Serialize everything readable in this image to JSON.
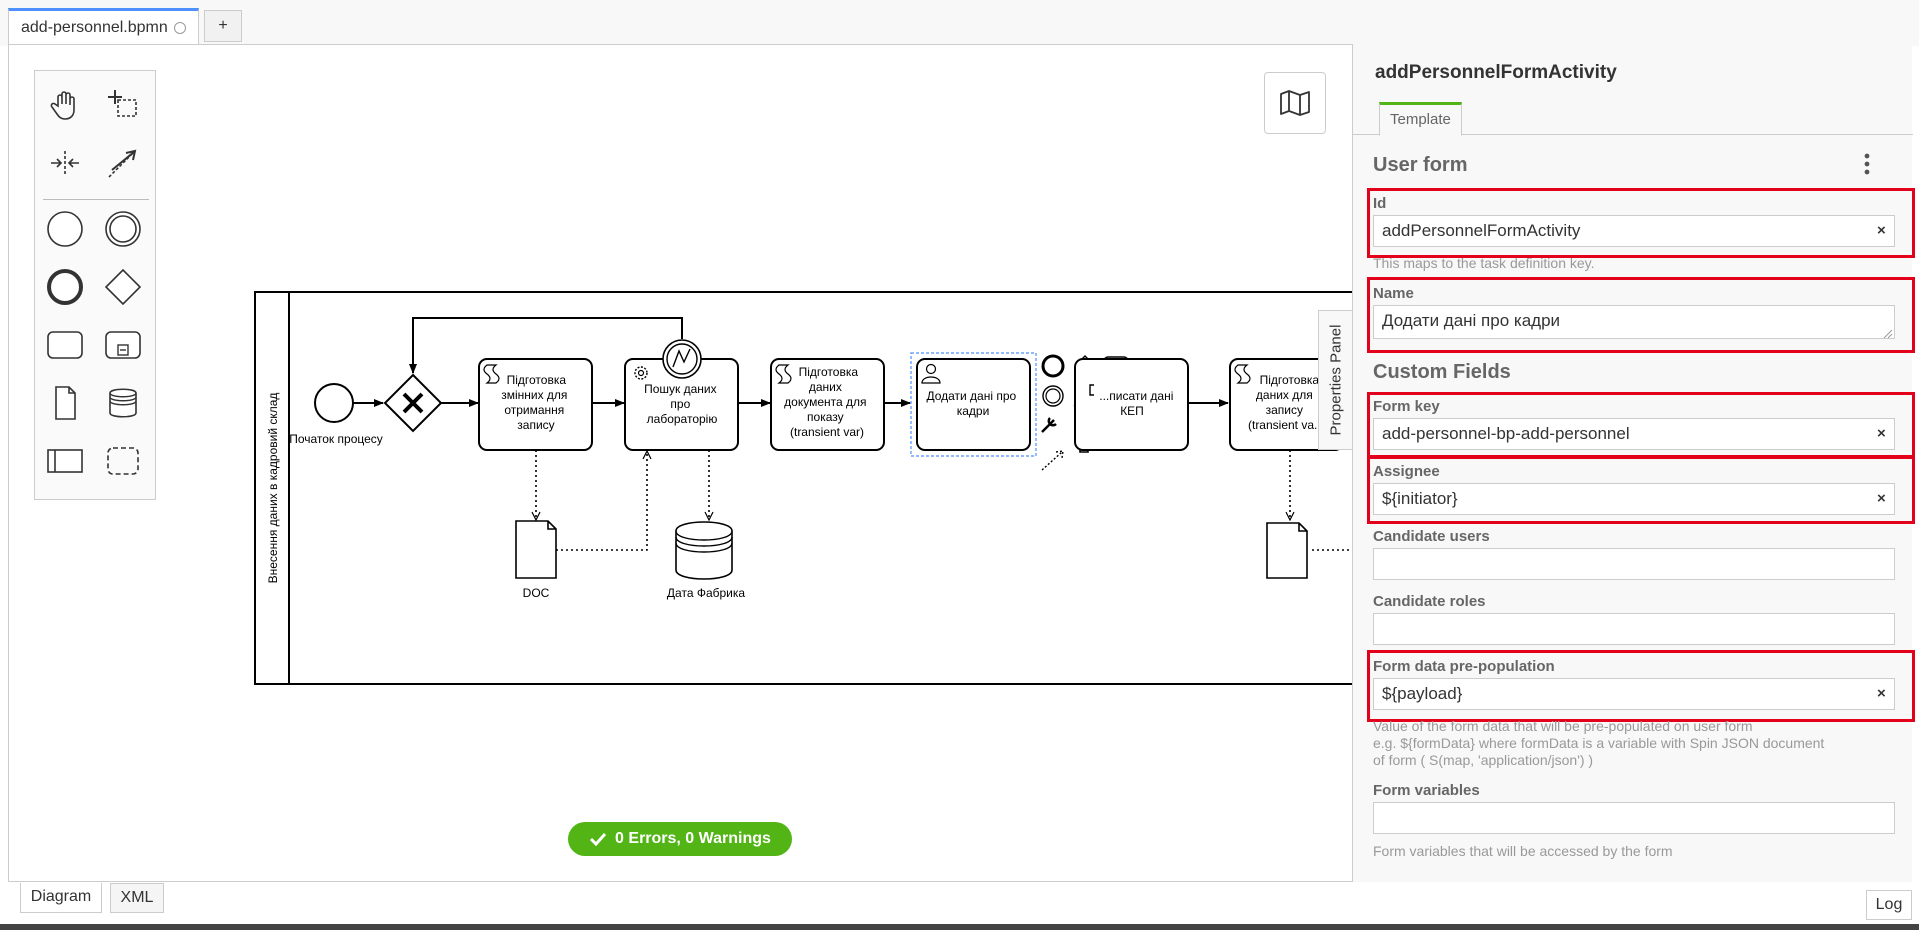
{
  "tabs": {
    "file_name": "add-personnel.bpmn",
    "add_label": "+"
  },
  "diagram": {
    "pool_label": "Внесення даних в кадровий склад",
    "start_event_label": "Початок процесу",
    "tasks": [
      [
        "Підготовка",
        "змінних для",
        "отримання",
        "запису"
      ],
      [
        "Пошук даних",
        "про",
        "лабораторію"
      ],
      [
        "Підготовка",
        "даних",
        "документа для",
        "показу",
        "(transient var)"
      ],
      [
        "Додати дані про",
        "кадри"
      ],
      [
        "...писати дані",
        "КЕП"
      ],
      [
        "Підготовка",
        "даних для",
        "запису",
        "(transient va..."
      ]
    ],
    "data_object_label": "DOC",
    "data_store_label": "Дата Фабрика"
  },
  "linting": {
    "status": "0 Errors, 0 Warnings"
  },
  "properties_panel": {
    "toggle_label": "Properties Panel",
    "element_name": "addPersonnelFormActivity",
    "tab_label": "Template",
    "user_form_group": "User form",
    "id_label": "Id",
    "id_value": "addPersonnelFormActivity",
    "id_desc": "This maps to the task definition key.",
    "name_label": "Name",
    "name_value": "Додати дані про кадри",
    "custom_fields_group": "Custom Fields",
    "form_key_label": "Form key",
    "form_key_value": "add-personnel-bp-add-personnel",
    "assignee_label": "Assignee",
    "assignee_value": "${initiator}",
    "candidate_users_label": "Candidate users",
    "candidate_roles_label": "Candidate roles",
    "prepopulation_label": "Form data pre-population",
    "prepopulation_value": "${payload}",
    "prepopulation_desc_1": "Value of the form data that will be pre-populated on user form",
    "prepopulation_desc_2": "e.g. ${formData} where formData is a variable with Spin JSON document",
    "prepopulation_desc_3": "of form ( S(map, 'application/json') )",
    "form_variables_label": "Form variables",
    "form_variables_desc": "Form variables that will be accessed by the form",
    "clear_symbol": "×"
  },
  "bottom": {
    "diagram_tab": "Diagram",
    "xml_tab": "XML",
    "log_button": "Log"
  },
  "colors": {
    "highlight": "#e2001a",
    "success": "#52b415",
    "tab_accent": "#4d90fe"
  }
}
